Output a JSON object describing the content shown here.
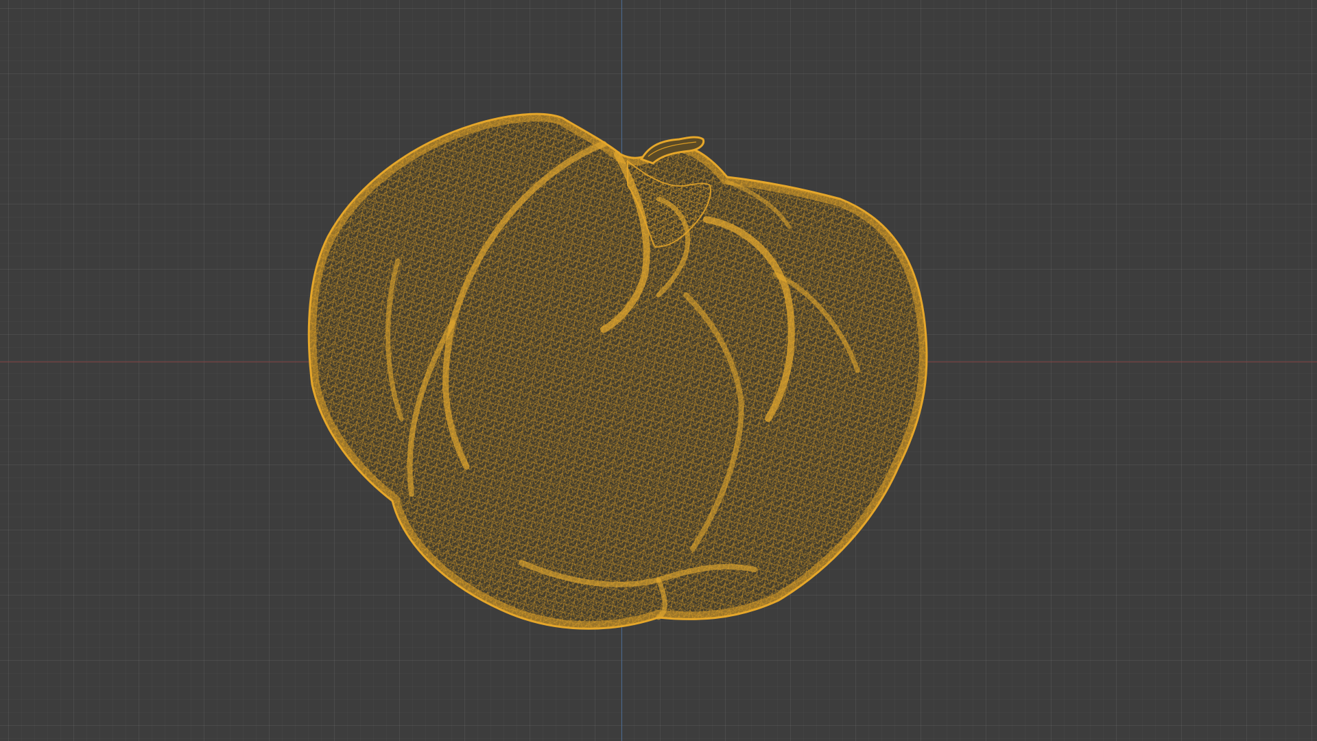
{
  "viewport": {
    "background_color": "#3d3d3d",
    "grid_color": "#4a4a4a",
    "x_axis_color": "#8a4646",
    "y_axis_color": "#4a6e9a"
  },
  "object": {
    "name": "pumpkin-wireframe-mesh",
    "display_mode": "wireframe",
    "wire_color": "#e6a72a"
  }
}
